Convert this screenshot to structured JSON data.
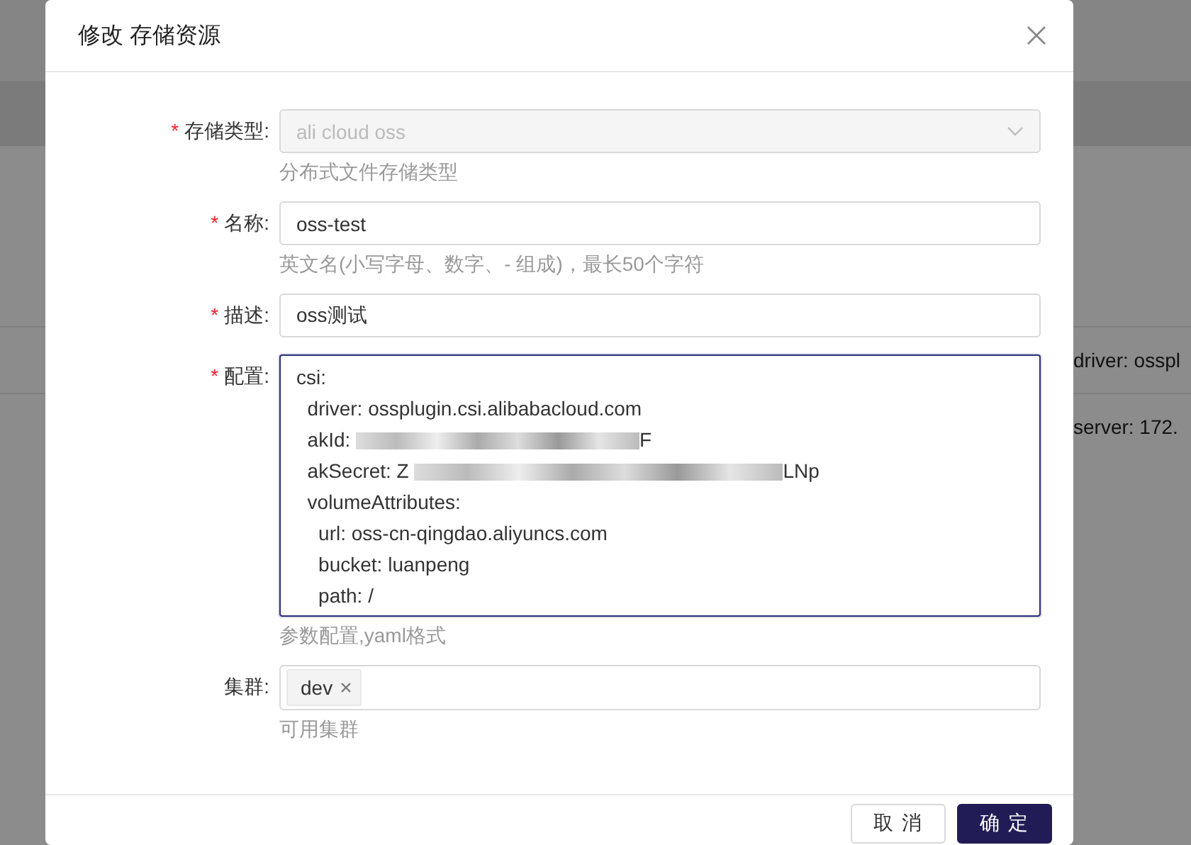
{
  "background": {
    "row_texts": [
      "driver: osspl",
      "server: 172."
    ]
  },
  "dialog": {
    "title": "修改 存储资源",
    "required_mark": "*",
    "label_suffix": ":",
    "fields": [
      {
        "kind": "select",
        "label": "存储类型",
        "required": true,
        "disabled": true,
        "value": "ali cloud oss",
        "help": "分布式文件存储类型"
      },
      {
        "kind": "input",
        "label": "名称",
        "required": true,
        "value": "oss-test",
        "help": "英文名(小写字母、数字、- 组成)，最长50个字符"
      },
      {
        "kind": "input",
        "label": "描述",
        "required": true,
        "value": "oss测试"
      },
      {
        "kind": "textarea",
        "label": "配置",
        "required": true,
        "focused": true,
        "help": "参数配置,yaml格式",
        "lines": [
          {
            "text": "csi:",
            "masked": false
          },
          {
            "text": "  driver: ossplugin.csi.alibabacloud.com",
            "masked": false
          },
          {
            "text": "  akId:",
            "masked": true,
            "tail": "F"
          },
          {
            "text": "  akSecret: Z",
            "masked": true,
            "tail": "LNp"
          },
          {
            "text": "  volumeAttributes:",
            "masked": false
          },
          {
            "text": "    url: oss-cn-qingdao.aliyuncs.com",
            "masked": false
          },
          {
            "text": "    bucket: luanpeng",
            "masked": false
          },
          {
            "text": "    path: /",
            "masked": false
          }
        ]
      },
      {
        "kind": "tags",
        "label": "集群",
        "required": false,
        "tags": [
          "dev"
        ],
        "help": "可用集群"
      }
    ],
    "buttons": [
      {
        "label": "取 消",
        "kind": "default"
      },
      {
        "label": "确 定",
        "kind": "primary"
      }
    ]
  }
}
